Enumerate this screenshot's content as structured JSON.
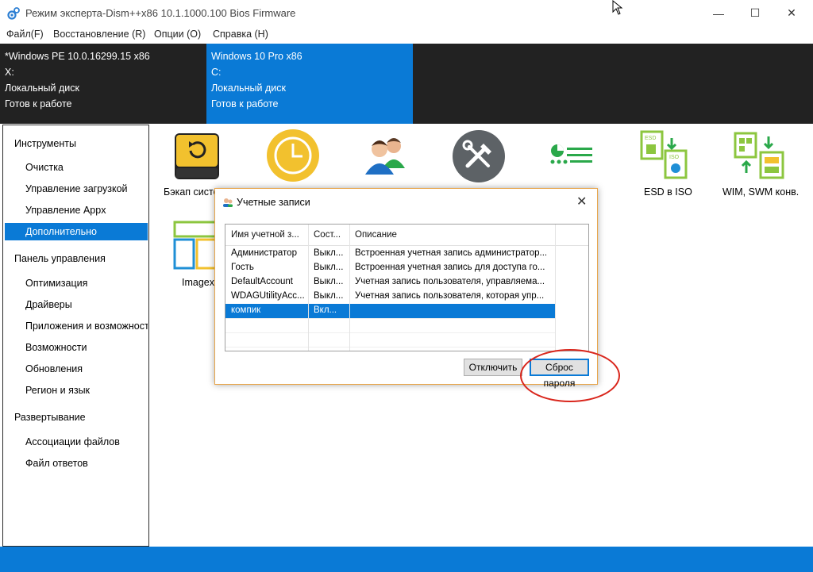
{
  "window": {
    "title": "Режим эксперта-Dism++x86 10.1.1000.100 Bios Firmware",
    "minimize": "—",
    "maximize": "☐",
    "close": "✕"
  },
  "menu": [
    "Файл(F)",
    "Восстановление (R)",
    "Опции (O)",
    "Справка (H)"
  ],
  "images": [
    {
      "line1": "*Windows PE 10.0.16299.15 x86",
      "line2": "X:",
      "line3": "Локальный диск",
      "line4": "Готов к работе"
    },
    {
      "line1": "Windows 10 Pro x86",
      "line2": "C:",
      "line3": "Локальный диск",
      "line4": "Готов к работе"
    }
  ],
  "sidebar": {
    "categories": [
      "Инструменты",
      "Панель управления",
      "Развертывание"
    ],
    "items": [
      "Очистка",
      "Управление загрузкой",
      "Управление Appx",
      "Дополнительно",
      "Оптимизация",
      "Драйверы",
      "Приложения и возможности",
      "Возможности",
      "Обновления",
      "Регион и язык",
      "Ассоциации файлов",
      "Файл ответов"
    ]
  },
  "tools": {
    "backup_label": "Бэкап систе",
    "esd_label": "ESD в ISO",
    "wim_label": "WIM, SWM конв.",
    "imagex_label": "Imagex",
    "icon_colors": {
      "yellow": "#f2c12e",
      "gray": "#5d6266",
      "green": "#2aa84a",
      "lime": "#8cc63f"
    }
  },
  "dialog": {
    "title": "Учетные записи",
    "columns": [
      "Имя учетной з...",
      "Сост...",
      "Описание"
    ],
    "rows": [
      {
        "name": "Администратор",
        "state": "Выкл...",
        "desc": "Встроенная учетная запись администратор..."
      },
      {
        "name": "Гость",
        "state": "Выкл...",
        "desc": "Встроенная учетная запись для доступа го..."
      },
      {
        "name": "DefaultAccount",
        "state": "Выкл...",
        "desc": "Учетная запись пользователя, управляема..."
      },
      {
        "name": "WDAGUtilityAcc...",
        "state": "Выкл...",
        "desc": "Учетная запись пользователя, которая упр..."
      },
      {
        "name": "компик",
        "state": "Вкл...",
        "desc": ""
      }
    ],
    "selected_row": 4,
    "disable_button": "Отключить",
    "reset_button": "Сброс пароля"
  },
  "colors": {
    "accent": "#0a7ad6",
    "header_bg": "#222222",
    "highlight": "#d9261c"
  }
}
